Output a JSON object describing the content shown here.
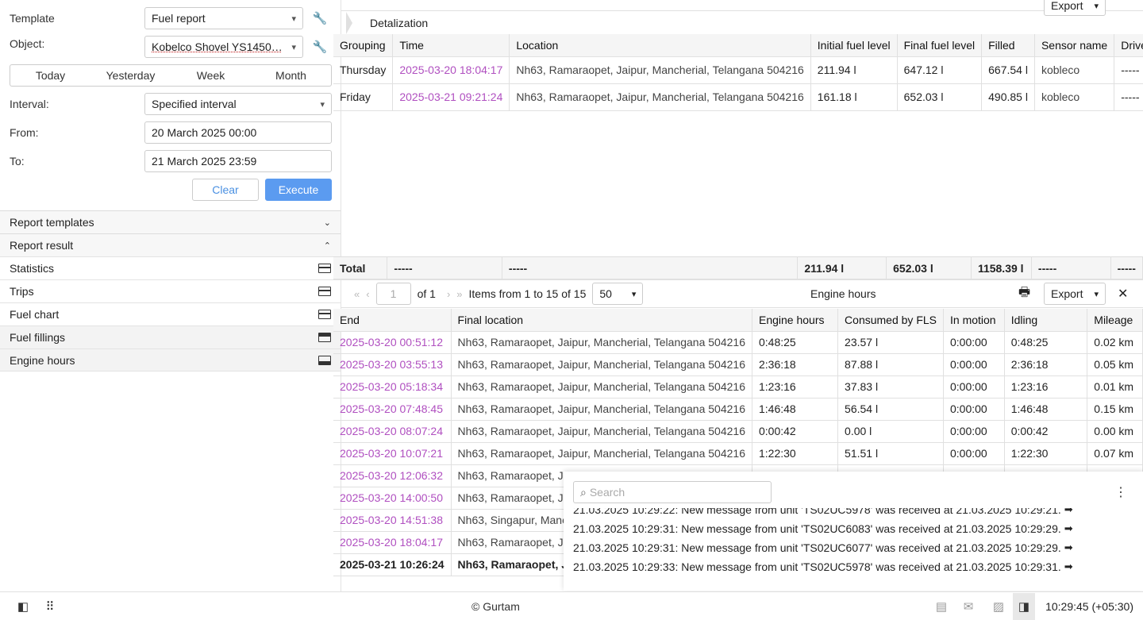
{
  "form": {
    "template_label": "Template",
    "template_value": "Fuel report",
    "object_label": "Object:",
    "object_value": "Kobelco Shovel YS1450…",
    "periods": [
      "Today",
      "Yesterday",
      "Week",
      "Month"
    ],
    "interval_label": "Interval:",
    "interval_value": "Specified interval",
    "from_label": "From:",
    "from_value": "20 March 2025 00:00",
    "to_label": "To:",
    "to_value": "21 March 2025 23:59",
    "clear_label": "Clear",
    "execute_label": "Execute"
  },
  "sections": {
    "templates": "Report templates",
    "result": "Report result"
  },
  "result_items": [
    "Statistics",
    "Trips",
    "Fuel chart",
    "Fuel fillings",
    "Engine hours"
  ],
  "top": {
    "detalization": "Detalization",
    "export": "Export"
  },
  "fillings": {
    "columns": [
      "Grouping",
      "Time",
      "Location",
      "Initial fuel level",
      "Final fuel level",
      "Filled",
      "Sensor name",
      "Driver"
    ],
    "rows": [
      [
        "Thursday",
        "2025-03-20 18:04:17",
        "Nh63, Ramaraopet, Jaipur, Mancherial, Telangana 504216",
        "211.94 l",
        "647.12 l",
        "667.54 l",
        "kobleco",
        "-----"
      ],
      [
        "Friday",
        "2025-03-21 09:21:24",
        "Nh63, Ramaraopet, Jaipur, Mancherial, Telangana 504216",
        "161.18 l",
        "652.03 l",
        "490.85 l",
        "kobleco",
        "-----"
      ]
    ],
    "total": [
      "Total",
      "-----",
      "-----",
      "211.94 l",
      "652.03 l",
      "1158.39 l",
      "-----",
      "-----"
    ]
  },
  "pager": {
    "page": "1",
    "of": "of 1",
    "items": "Items from 1 to 15 of 15",
    "size": "50",
    "title": "Engine hours",
    "export": "Export"
  },
  "engine": {
    "columns": [
      "End",
      "Final location",
      "Engine hours",
      "Consumed by FLS",
      "In motion",
      "Idling",
      "Mileage"
    ],
    "rows": [
      [
        "2025-03-20 00:51:12",
        "Nh63, Ramaraopet, Jaipur, Mancherial, Telangana 504216",
        "0:48:25",
        "23.57 l",
        "0:00:00",
        "0:48:25",
        "0.02 km"
      ],
      [
        "2025-03-20 03:55:13",
        "Nh63, Ramaraopet, Jaipur, Mancherial, Telangana 504216",
        "2:36:18",
        "87.88 l",
        "0:00:00",
        "2:36:18",
        "0.05 km"
      ],
      [
        "2025-03-20 05:18:34",
        "Nh63, Ramaraopet, Jaipur, Mancherial, Telangana 504216",
        "1:23:16",
        "37.83 l",
        "0:00:00",
        "1:23:16",
        "0.01 km"
      ],
      [
        "2025-03-20 07:48:45",
        "Nh63, Ramaraopet, Jaipur, Mancherial, Telangana 504216",
        "1:46:48",
        "56.54 l",
        "0:00:00",
        "1:46:48",
        "0.15 km"
      ],
      [
        "2025-03-20 08:07:24",
        "Nh63, Ramaraopet, Jaipur, Mancherial, Telangana 504216",
        "0:00:42",
        "0.00 l",
        "0:00:00",
        "0:00:42",
        "0.00 km"
      ],
      [
        "2025-03-20 10:07:21",
        "Nh63, Ramaraopet, Jaipur, Mancherial, Telangana 504216",
        "1:22:30",
        "51.51 l",
        "0:00:00",
        "1:22:30",
        "0.07 km"
      ],
      [
        "2025-03-20 12:06:32",
        "Nh63, Ramaraopet, Ja",
        "",
        "",
        "",
        "",
        ""
      ],
      [
        "2025-03-20 14:00:50",
        "Nh63, Ramaraopet, Ja",
        "",
        "",
        "",
        "",
        ""
      ],
      [
        "2025-03-20 14:51:38",
        "Nh63, Singapur, Manc",
        "",
        "",
        "",
        "",
        ""
      ],
      [
        "2025-03-20 18:04:17",
        "Nh63, Ramaraopet, Ja",
        "",
        "",
        "",
        "",
        ""
      ]
    ],
    "last": [
      "2025-03-21 10:26:24",
      "Nh63, Ramaraopet, Ja"
    ]
  },
  "notifications": {
    "search_placeholder": "Search",
    "messages": [
      "21.03.2025 10:29:22: New message from unit 'TS02UC5978' was received at 21.03.2025 10:29:21.",
      "21.03.2025 10:29:31: New message from unit 'TS02UC6083' was received at 21.03.2025 10:29:29.",
      "21.03.2025 10:29:31: New message from unit 'TS02UC6077' was received at 21.03.2025 10:29:29.",
      "21.03.2025 10:29:33: New message from unit 'TS02UC5978' was received at 21.03.2025 10:29:31."
    ]
  },
  "footer": {
    "copyright": "© Gurtam",
    "clock": "10:29:45 (+05:30)"
  },
  "colors": {
    "accent": "#5b9bf0",
    "time_link": "#b04fc0"
  }
}
